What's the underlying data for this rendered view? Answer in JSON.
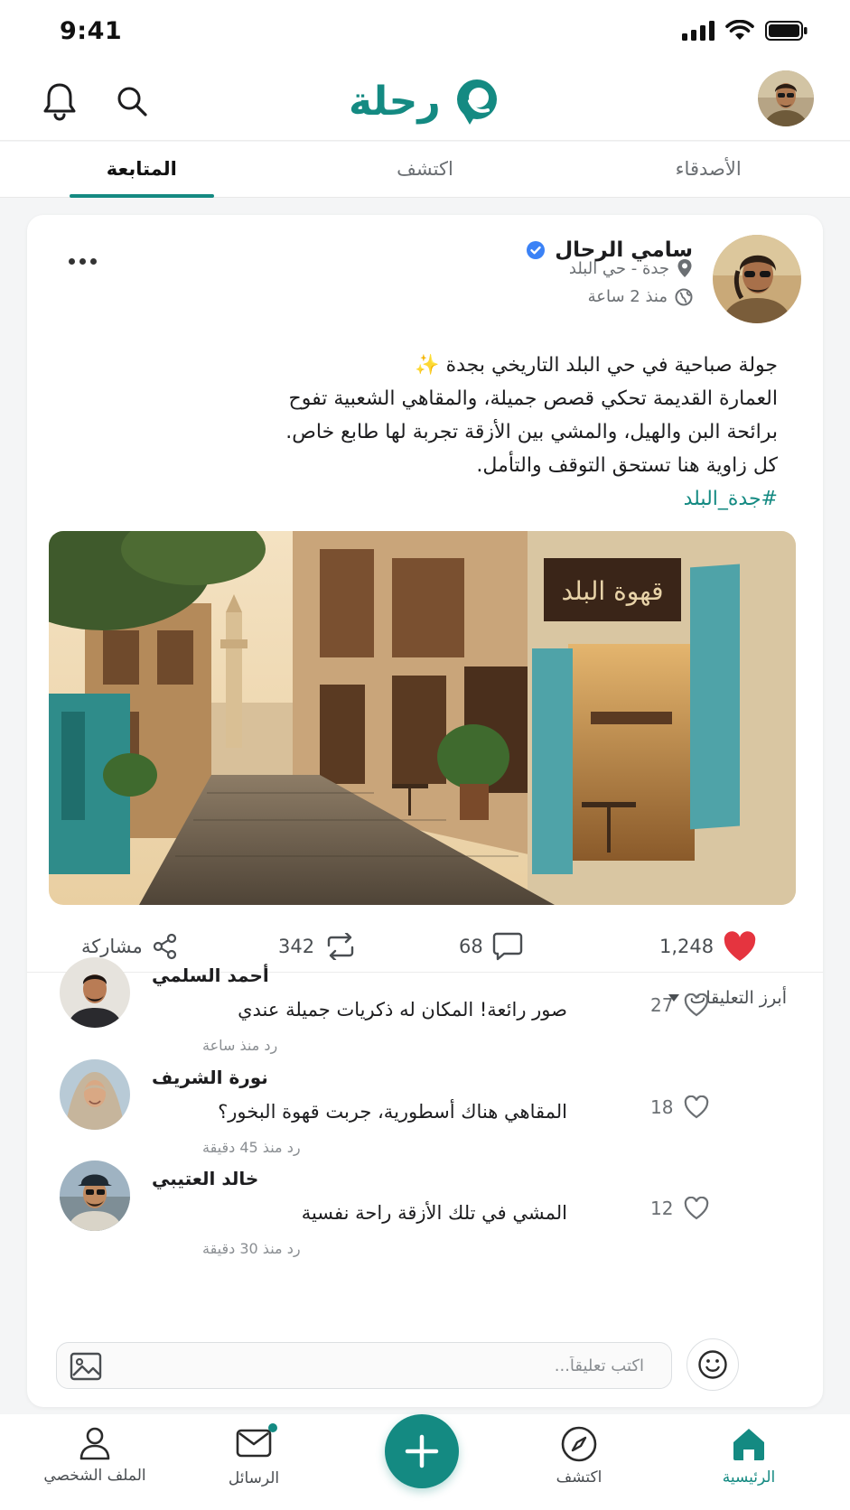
{
  "status_bar": {
    "time": "9:41"
  },
  "header": {
    "logo_text": "رحلة"
  },
  "tabs": [
    {
      "label": "الأصدقاء",
      "active": false
    },
    {
      "label": "اكتشف",
      "active": false
    },
    {
      "label": "المتابعة",
      "active": true
    }
  ],
  "post": {
    "author_name": "سامي الرحال",
    "verified": true,
    "location": "جدة - حي البلد",
    "time": "منذ 2 ساعة",
    "text_lines": [
      "جولة صباحية في حي البلد التاريخي بجدة ✨",
      "العمارة القديمة تحكي قصص جميلة، والمقاهي الشعبية تفوح",
      "برائحة البن والهيل، والمشي بين الأزقة تجربة لها طابع خاص.",
      "كل زاوية هنا تستحق التوقف والتأمل."
    ],
    "hashtag": "#جدة_البلد",
    "image_sign_text": "قهوة البلد",
    "stats": {
      "likes": "1,248",
      "comments": "68",
      "reposts": "342",
      "share_label": "مشاركة"
    }
  },
  "comments_section": {
    "header": "أبرز التعليقات",
    "reply_label": "رد",
    "items": [
      {
        "name": "أحمد السلمي",
        "text": "صور رائعة! المكان له ذكريات جميلة عندي",
        "time": "منذ ساعة",
        "likes": "27"
      },
      {
        "name": "نورة الشريف",
        "text": "المقاهي هناك أسطورية، جربت قهوة البخور؟",
        "time": "منذ 45 دقيقة",
        "likes": "18"
      },
      {
        "name": "خالد العتيبي",
        "text": "المشي في تلك الأزقة راحة نفسية",
        "time": "منذ 30 دقيقة",
        "likes": "12"
      }
    ],
    "composer_placeholder": "اكتب تعليقاً..."
  },
  "bottom_nav": {
    "home": "الرئيسية",
    "explore": "اكتشف",
    "messages": "الرسائل",
    "profile": "الملف الشخصي"
  },
  "colors": {
    "accent": "#148a82",
    "like": "#e5343f",
    "verified": "#3b82f6"
  }
}
